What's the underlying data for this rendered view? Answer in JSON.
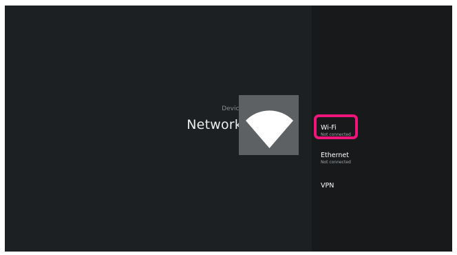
{
  "header": {
    "breadcrumb": "Device",
    "title": "Network"
  },
  "hero": {
    "icon": "wifi-icon"
  },
  "menu": {
    "items": [
      {
        "label": "Wi-Fi",
        "status": "Not connected",
        "selected": true
      },
      {
        "label": "Ethernet",
        "status": "Not connected",
        "selected": false
      },
      {
        "label": "VPN"
      }
    ]
  },
  "colors": {
    "focus_highlight": "#f0157a",
    "background": "#1d2023",
    "panel": "#17191b"
  }
}
